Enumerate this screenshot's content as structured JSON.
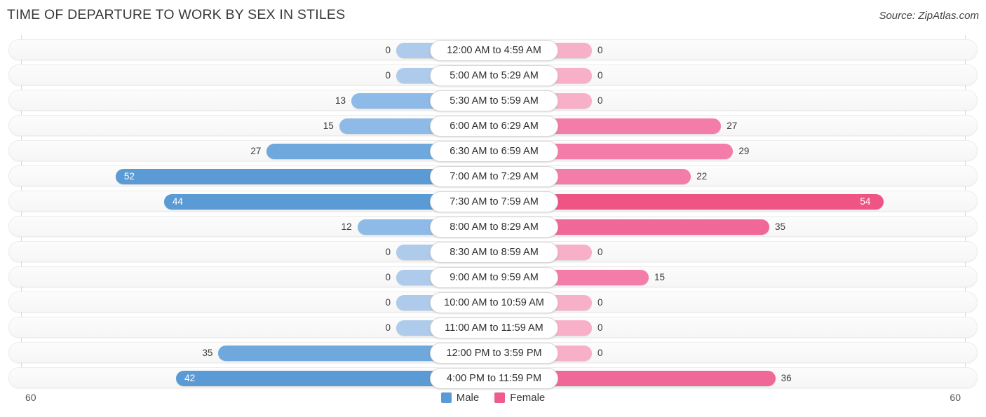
{
  "header": {
    "title": "TIME OF DEPARTURE TO WORK BY SEX IN STILES",
    "source": "Source: ZipAtlas.com"
  },
  "legend": {
    "male_label": "Male",
    "female_label": "Female",
    "male_color": "#5B9BD5",
    "female_color": "#EE5D8C"
  },
  "axis": {
    "left_tick": "60",
    "right_tick": "60",
    "max": 60
  },
  "chart_data": {
    "type": "bar",
    "title": "TIME OF DEPARTURE TO WORK BY SEX IN STILES",
    "subtitle": "",
    "xlabel": "",
    "ylabel": "",
    "orientation": "horizontal-diverging",
    "xlim": [
      60,
      60
    ],
    "grid": false,
    "legend_position": "bottom-center",
    "categories": [
      "12:00 AM to 4:59 AM",
      "5:00 AM to 5:29 AM",
      "5:30 AM to 5:59 AM",
      "6:00 AM to 6:29 AM",
      "6:30 AM to 6:59 AM",
      "7:00 AM to 7:29 AM",
      "7:30 AM to 7:59 AM",
      "8:00 AM to 8:29 AM",
      "8:30 AM to 8:59 AM",
      "9:00 AM to 9:59 AM",
      "10:00 AM to 10:59 AM",
      "11:00 AM to 11:59 AM",
      "12:00 PM to 3:59 PM",
      "4:00 PM to 11:59 PM"
    ],
    "series": [
      {
        "name": "Male",
        "values": [
          0,
          0,
          13,
          15,
          27,
          52,
          44,
          12,
          0,
          0,
          0,
          0,
          35,
          42
        ]
      },
      {
        "name": "Female",
        "values": [
          0,
          0,
          0,
          27,
          29,
          22,
          54,
          35,
          0,
          15,
          0,
          0,
          0,
          36
        ]
      }
    ]
  },
  "rows": [
    {
      "label": "12:00 AM to 4:59 AM",
      "male": "0",
      "female": "0"
    },
    {
      "label": "5:00 AM to 5:29 AM",
      "male": "0",
      "female": "0"
    },
    {
      "label": "5:30 AM to 5:59 AM",
      "male": "13",
      "female": "0"
    },
    {
      "label": "6:00 AM to 6:29 AM",
      "male": "15",
      "female": "27"
    },
    {
      "label": "6:30 AM to 6:59 AM",
      "male": "27",
      "female": "29"
    },
    {
      "label": "7:00 AM to 7:29 AM",
      "male": "52",
      "female": "22"
    },
    {
      "label": "7:30 AM to 7:59 AM",
      "male": "44",
      "female": "54"
    },
    {
      "label": "8:00 AM to 8:29 AM",
      "male": "12",
      "female": "35"
    },
    {
      "label": "8:30 AM to 8:59 AM",
      "male": "0",
      "female": "0"
    },
    {
      "label": "9:00 AM to 9:59 AM",
      "male": "0",
      "female": "15"
    },
    {
      "label": "10:00 AM to 10:59 AM",
      "male": "0",
      "female": "0"
    },
    {
      "label": "11:00 AM to 11:59 AM",
      "male": "0",
      "female": "0"
    },
    {
      "label": "12:00 PM to 3:59 PM",
      "male": "35",
      "female": "0"
    },
    {
      "label": "4:00 PM to 11:59 PM",
      "male": "42",
      "female": "36"
    }
  ]
}
